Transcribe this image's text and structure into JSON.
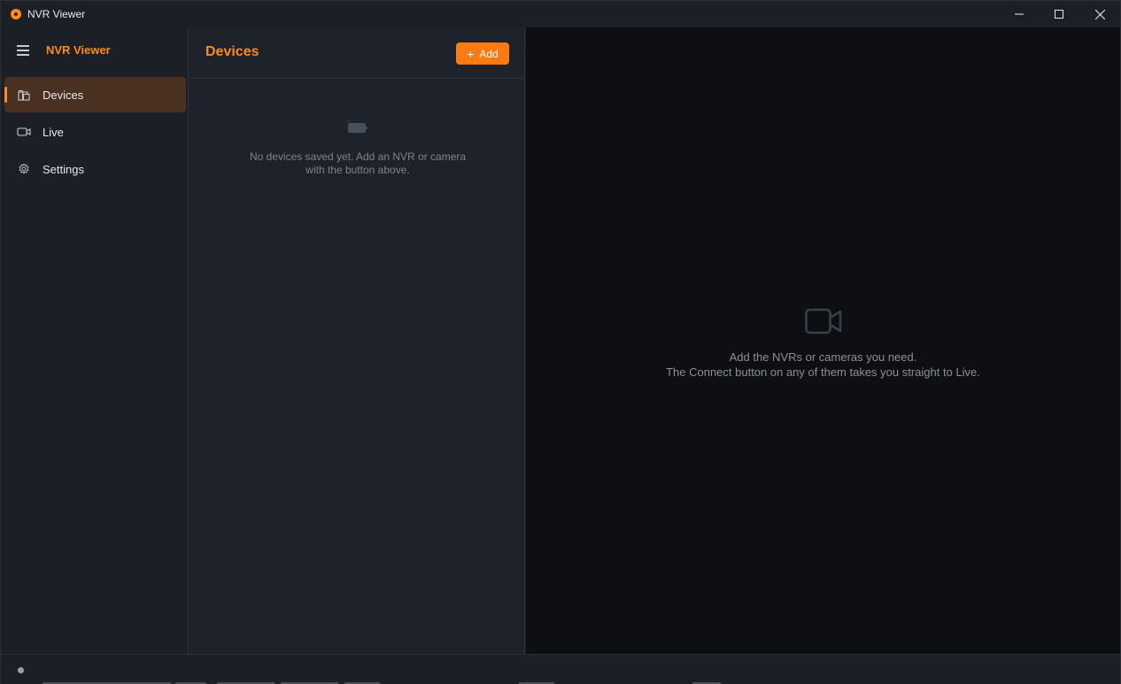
{
  "window": {
    "title": "NVR Viewer",
    "controls": [
      "minimize-icon",
      "maximize-icon",
      "close-icon"
    ]
  },
  "nav": {
    "title": "NVR Viewer",
    "items": [
      {
        "label": "Devices",
        "icon": "devices-icon",
        "active": true
      },
      {
        "label": "Live",
        "icon": "video-camera-icon",
        "active": false
      },
      {
        "label": "Settings",
        "icon": "gear-icon",
        "active": false
      }
    ]
  },
  "devices": {
    "title": "Devices",
    "add_label": "Add",
    "empty_line1": "No devices saved yet. Add an NVR or camera",
    "empty_line2": "with the button above."
  },
  "live": {
    "line1": "Add the NVRs or cameras you need.",
    "line2": "The Connect button on any of them takes you straight to Live."
  },
  "colors": {
    "accent": "#ff8a1f",
    "active_bg": "#4a3020",
    "live_bg": "#0d0f13"
  }
}
